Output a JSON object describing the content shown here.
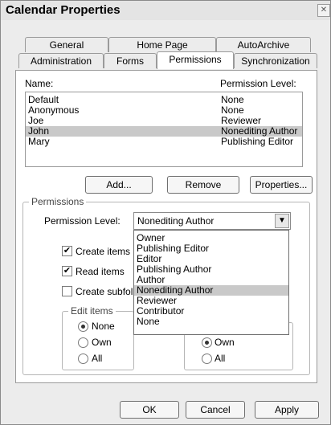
{
  "window": {
    "title": "Calendar Properties",
    "close_glyph": "✕"
  },
  "tabs": {
    "row1": [
      "General",
      "Home Page",
      "AutoArchive"
    ],
    "row2": [
      "Administration",
      "Forms",
      "Permissions",
      "Synchronization"
    ],
    "active": "Permissions"
  },
  "list": {
    "name_header": "Name:",
    "level_header": "Permission Level:",
    "rows": [
      {
        "name": "Default",
        "level": "None"
      },
      {
        "name": "Anonymous",
        "level": "None"
      },
      {
        "name": "Joe",
        "level": "Reviewer"
      },
      {
        "name": "John",
        "level": "Nonediting Author"
      },
      {
        "name": "Mary",
        "level": "Publishing Editor"
      }
    ],
    "selected_index": 3
  },
  "list_buttons": {
    "add": "Add...",
    "remove": "Remove",
    "properties": "Properties..."
  },
  "permissions": {
    "group_label": "Permissions",
    "level_label": "Permission Level:",
    "level_value": "Nonediting Author",
    "options": [
      "Owner",
      "Publishing Editor",
      "Editor",
      "Publishing Author",
      "Author",
      "Nonediting Author",
      "Reviewer",
      "Contributor",
      "None"
    ],
    "highlighted_index": 5,
    "create_items": {
      "label": "Create items",
      "checked": true
    },
    "read_items": {
      "label": "Read items",
      "checked": true
    },
    "create_subfolders": {
      "label": "Create subfol",
      "checked": false
    },
    "edit_items": {
      "label": "Edit items",
      "none": "None",
      "own": "Own",
      "all": "All",
      "selected": "none"
    },
    "delete_items": {
      "own": "Own",
      "all": "All",
      "selected": "own"
    }
  },
  "footer": {
    "ok": "OK",
    "cancel": "Cancel",
    "apply": "Apply"
  }
}
